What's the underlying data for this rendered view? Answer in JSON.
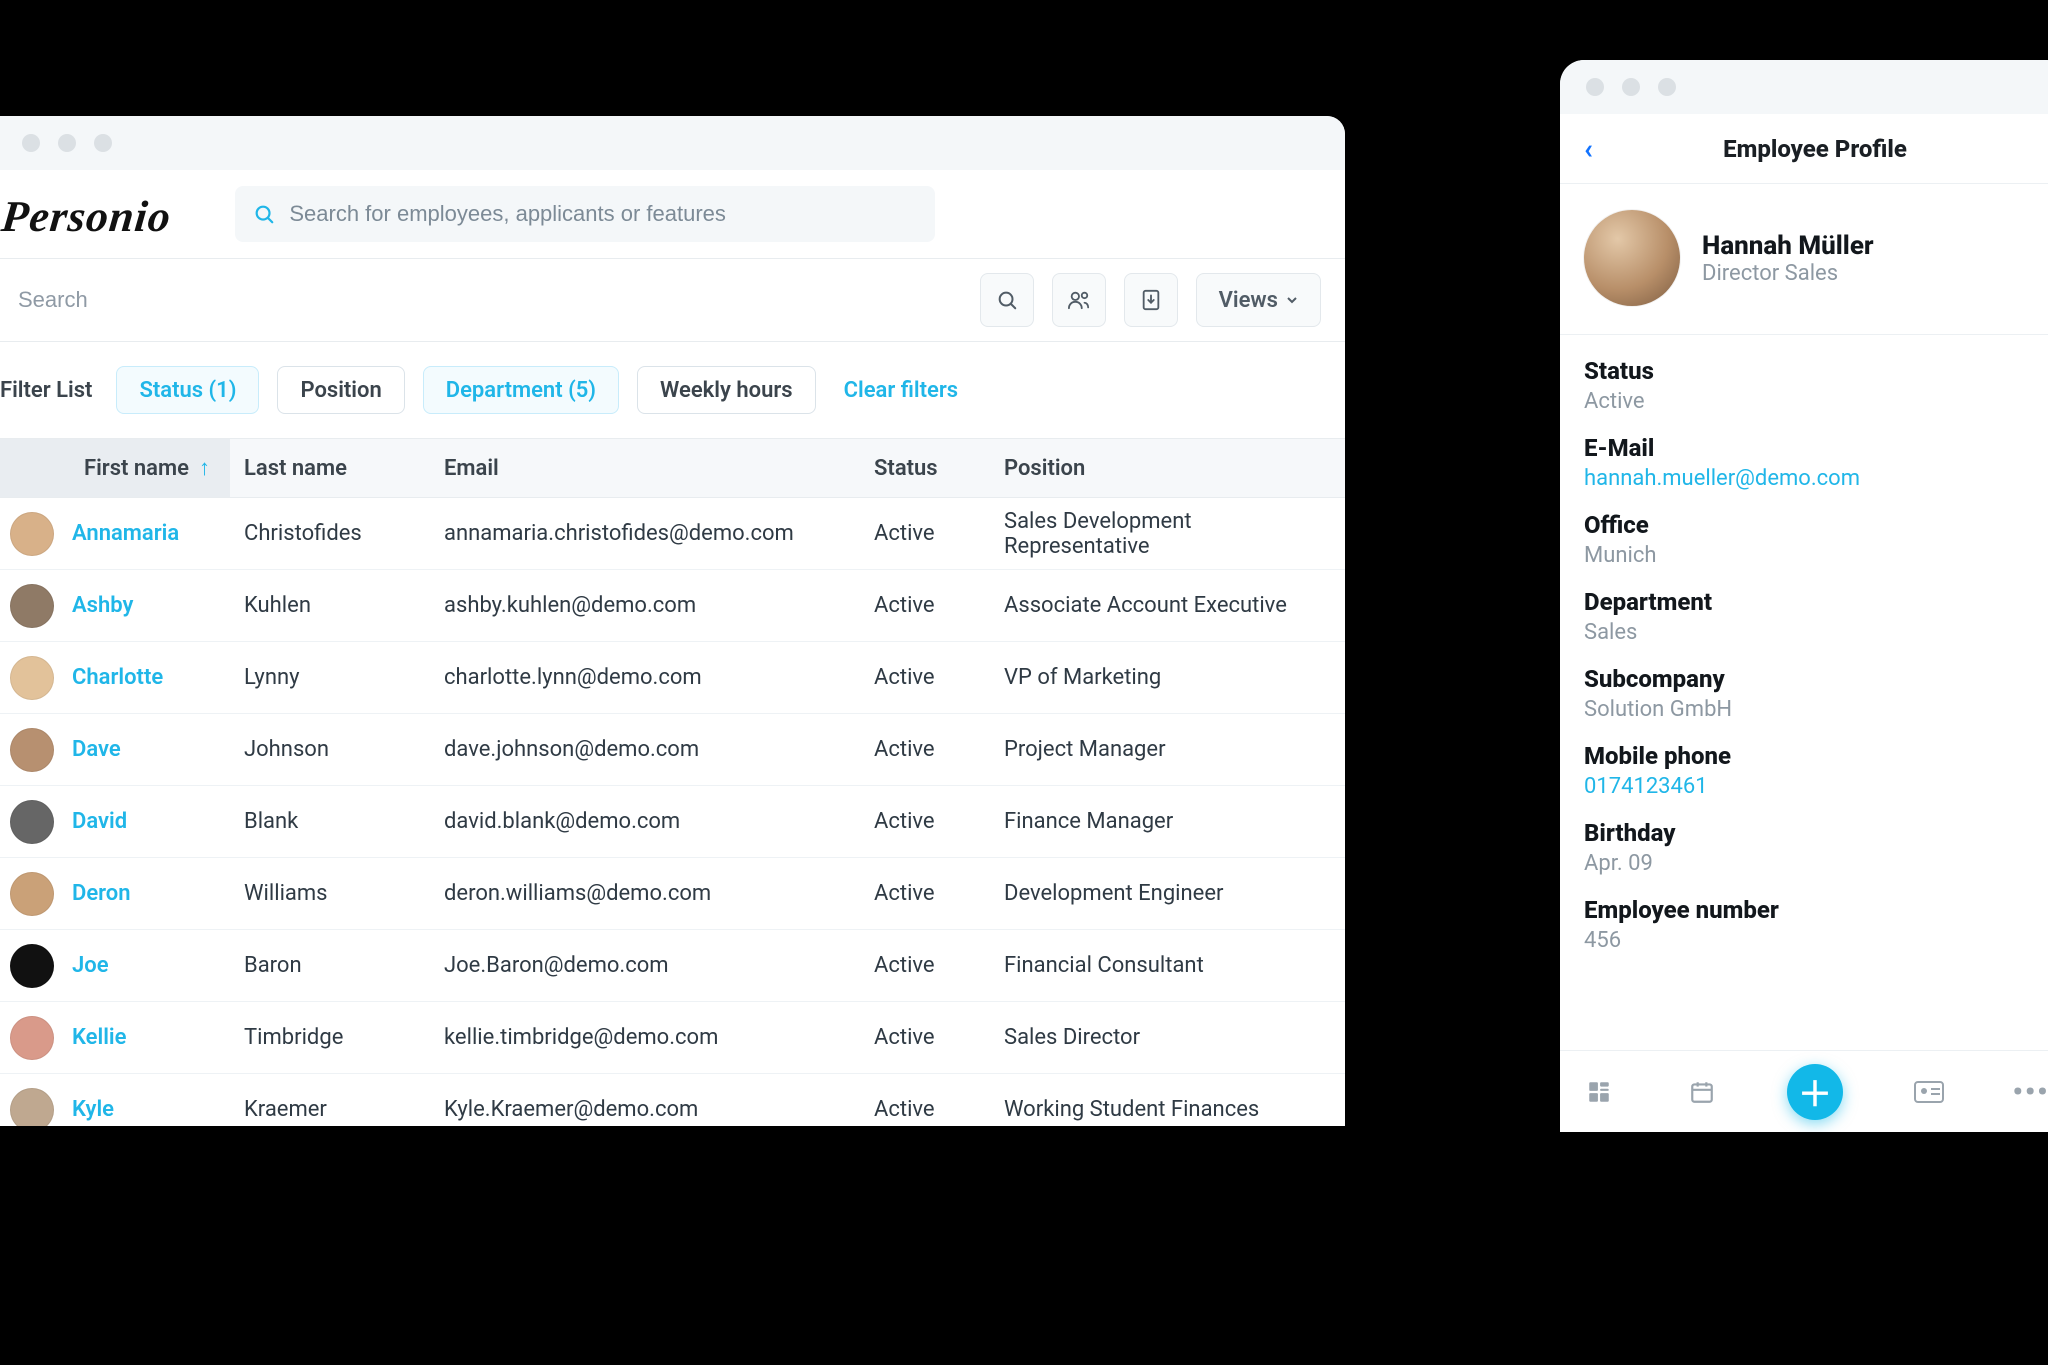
{
  "brand": "Personio",
  "globalSearch": {
    "placeholder": "Search for employees, applicants or features"
  },
  "listSearch": {
    "placeholder": "Search"
  },
  "viewsLabel": "Views",
  "filterListLabel": "Filter List",
  "filters": [
    {
      "label": "Status (1)",
      "active": true
    },
    {
      "label": "Position",
      "active": false
    },
    {
      "label": "Department (5)",
      "active": true
    },
    {
      "label": "Weekly hours",
      "active": false
    }
  ],
  "clearFiltersLabel": "Clear filters",
  "columns": {
    "firstName": "First name",
    "lastName": "Last name",
    "email": "Email",
    "status": "Status",
    "position": "Position"
  },
  "rows": [
    {
      "first": "Annamaria",
      "last": "Christofides",
      "email": "annamaria.christofides@demo.com",
      "status": "Active",
      "position": "Sales Development Representative",
      "avatar": "#d8b189"
    },
    {
      "first": "Ashby",
      "last": "Kuhlen",
      "email": "ashby.kuhlen@demo.com",
      "status": "Active",
      "position": "Associate Account Executive",
      "avatar": "#8f7a66"
    },
    {
      "first": "Charlotte",
      "last": "Lynny",
      "email": "charlotte.lynn@demo.com",
      "status": "Active",
      "position": "VP of Marketing",
      "avatar": "#e2c29a"
    },
    {
      "first": "Dave",
      "last": "Johnson",
      "email": "dave.johnson@demo.com",
      "status": "Active",
      "position": "Project Manager",
      "avatar": "#b79070"
    },
    {
      "first": "David",
      "last": "Blank",
      "email": "david.blank@demo.com",
      "status": "Active",
      "position": "Finance Manager",
      "avatar": "#666"
    },
    {
      "first": "Deron",
      "last": "Williams",
      "email": "deron.williams@demo.com",
      "status": "Active",
      "position": "Development Engineer",
      "avatar": "#caa178"
    },
    {
      "first": "Joe",
      "last": "Baron",
      "email": "Joe.Baron@demo.com",
      "status": "Active",
      "position": "Financial Consultant",
      "avatar": "#111"
    },
    {
      "first": "Kellie",
      "last": "Timbridge",
      "email": "kellie.timbridge@demo.com",
      "status": "Active",
      "position": "Sales Director",
      "avatar": "#d99a8a"
    },
    {
      "first": "Kyle",
      "last": "Kraemer",
      "email": "Kyle.Kraemer@demo.com",
      "status": "Active",
      "position": "Working Student Finances",
      "avatar": "#bfa890"
    }
  ],
  "profile": {
    "headerTitle": "Employee Profile",
    "name": "Hannah Müller",
    "role": "Director Sales",
    "fields": {
      "statusLabel": "Status",
      "status": "Active",
      "emailLabel": "E-Mail",
      "email": "hannah.mueller@demo.com",
      "officeLabel": "Office",
      "office": "Munich",
      "deptLabel": "Department",
      "dept": "Sales",
      "subcoLabel": "Subcompany",
      "subco": "Solution GmbH",
      "phoneLabel": "Mobile phone",
      "phone": "0174123461",
      "bdayLabel": "Birthday",
      "bday": "Apr. 09",
      "empnoLabel": "Employee number",
      "empno": "456"
    }
  }
}
